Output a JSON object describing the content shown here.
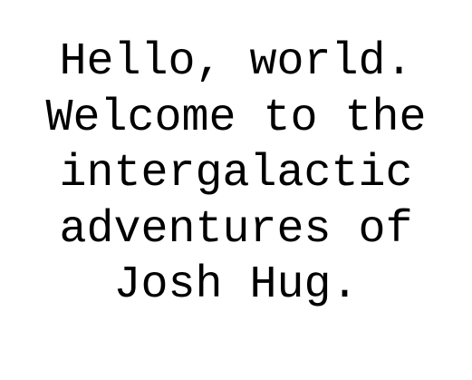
{
  "lines": [
    "Hello, world.",
    "Welcome to the",
    "intergalactic",
    "adventures of",
    "Josh Hug."
  ]
}
